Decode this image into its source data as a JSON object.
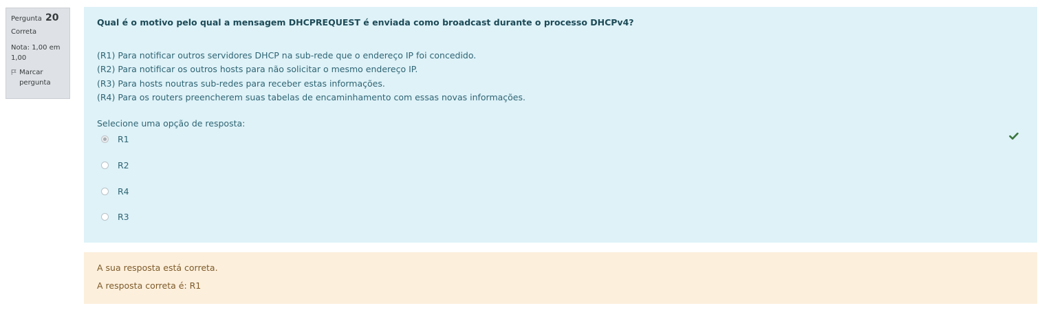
{
  "info": {
    "question_label": "Pergunta",
    "question_number": "20",
    "state": "Correta",
    "grade": "Nota: 1,00 em 1,00",
    "flag_label": "Marcar pergunta"
  },
  "question": {
    "text": "Qual é o motivo pelo qual a mensagem DHCPREQUEST é enviada como broadcast durante o processo DHCPv4?",
    "reasons": [
      "(R1) Para notificar outros servidores DHCP na sub-rede que o endereço IP foi concedido.",
      "(R2) Para notificar os outros hosts para não solicitar o mesmo endereço IP.",
      "(R3) Para hosts noutras sub-redes para receber estas informações.",
      "(R4) Para os routers preencherem suas tabelas de encaminhamento com essas novas informações."
    ],
    "prompt": "Selecione uma opção de resposta:",
    "options": [
      {
        "label": "R1",
        "checked": true
      },
      {
        "label": "R2",
        "checked": false
      },
      {
        "label": "R4",
        "checked": false
      },
      {
        "label": "R3",
        "checked": false
      }
    ],
    "correct_icon": "check-icon",
    "colors": {
      "content_bg": "#def2f8",
      "feedback_bg": "#fcefdc",
      "check": "#3c763d"
    }
  },
  "feedback": {
    "line1": "A sua resposta está correta.",
    "line2": "A resposta correta é: R1"
  }
}
